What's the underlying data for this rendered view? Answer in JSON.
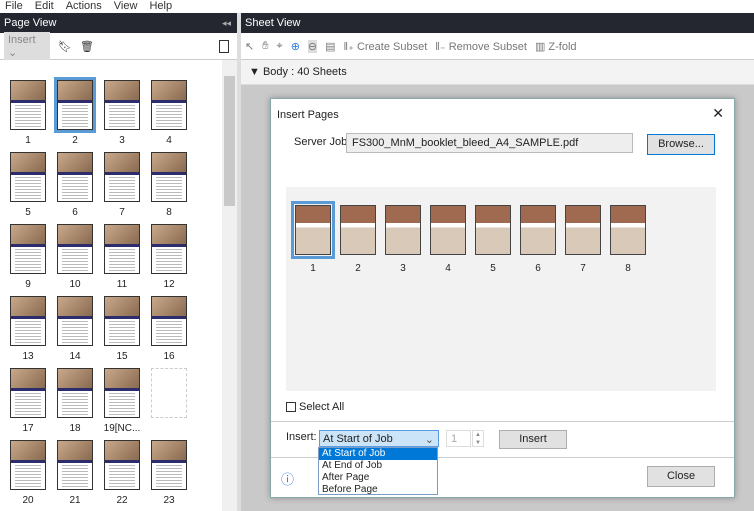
{
  "menu": [
    "File",
    "Edit",
    "Actions",
    "View",
    "Help"
  ],
  "page_view": {
    "title": "Page View",
    "insert_select": "Insert",
    "pages": [
      "1",
      "2",
      "3",
      "4",
      "5",
      "6",
      "7",
      "8",
      "9",
      "10",
      "11",
      "12",
      "13",
      "14",
      "15",
      "16",
      "17",
      "18",
      "19[NC...",
      "",
      "20",
      "21",
      "22",
      "23"
    ],
    "selected": "2"
  },
  "sheet_view": {
    "title": "Sheet View",
    "create_subset": "Create Subset",
    "remove_subset": "Remove Subset",
    "zfold": "Z-fold",
    "body_label": "Body : 40 Sheets"
  },
  "dialog": {
    "title": "Insert Pages",
    "server_job_label": "Server Job:",
    "server_job_value": "FS300_MnM_booklet_bleed_A4_SAMPLE.pdf",
    "browse": "Browse...",
    "pages": [
      "1",
      "2",
      "3",
      "4",
      "5",
      "6",
      "7",
      "8"
    ],
    "selected": "1",
    "select_all": "Select All",
    "insert_label": "Insert:",
    "insert_value": "At Start of Job",
    "page_number": "1",
    "insert_button": "Insert",
    "close_button": "Close",
    "options": [
      "At Start of Job",
      "At End of Job",
      "After Page",
      "Before Page"
    ]
  }
}
